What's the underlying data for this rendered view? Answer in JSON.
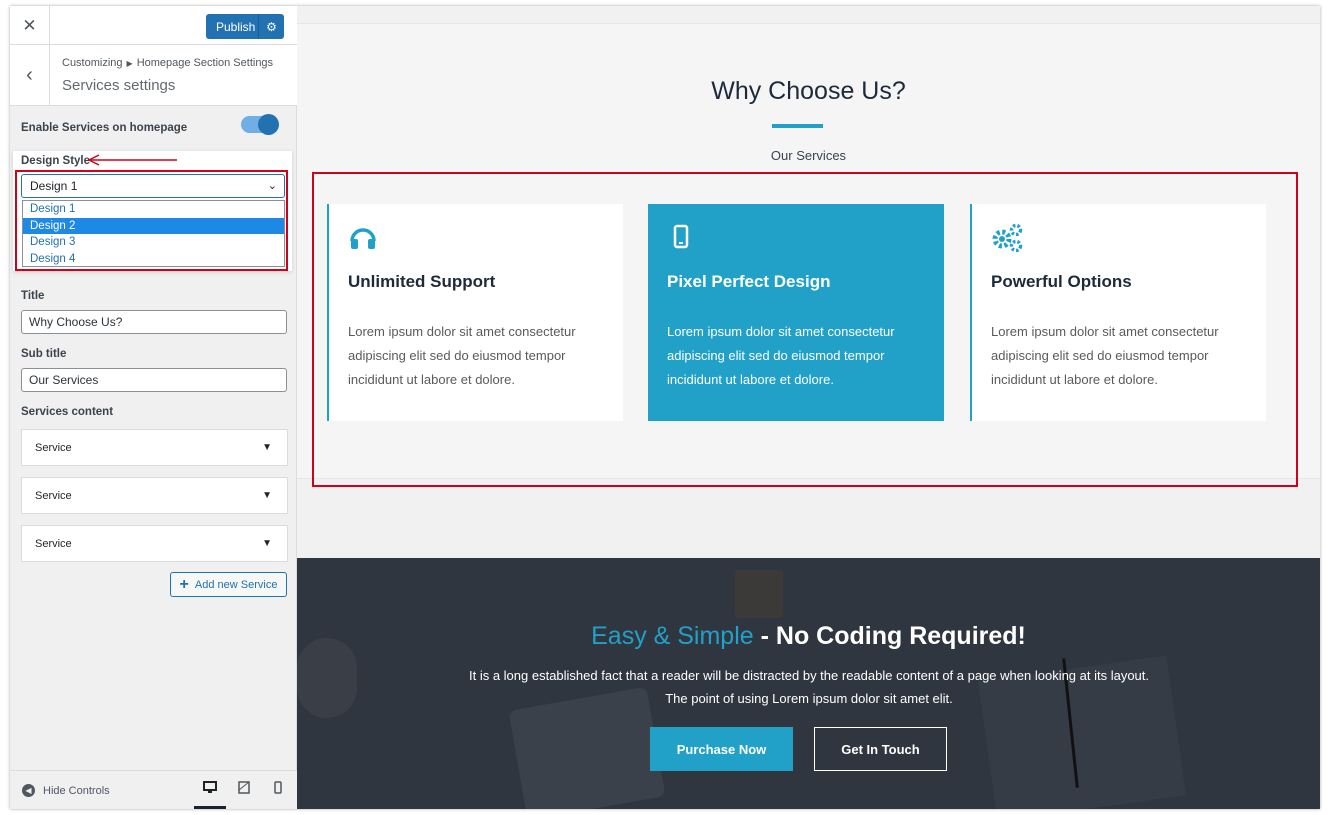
{
  "sidebar": {
    "publish_label": "Publish",
    "breadcrumb": [
      "Customizing",
      "Homepage Section Settings"
    ],
    "section_title": "Services settings",
    "enable_label": "Enable Services on homepage",
    "enable_on": true,
    "design_style": {
      "label": "Design Style",
      "selected": "Design 1",
      "options": [
        "Design 1",
        "Design 2",
        "Design 3",
        "Design 4"
      ],
      "highlighted": "Design 2"
    },
    "title_label": "Title",
    "title_value": "Why Choose Us?",
    "subtitle_label": "Sub title",
    "subtitle_value": "Our Services",
    "services_label": "Services content",
    "services": [
      "Service",
      "Service",
      "Service"
    ],
    "add_service_label": "Add new Service",
    "hide_controls_label": "Hide Controls",
    "colors": {
      "accent": "#2271b1",
      "annotation": "#d0021b"
    }
  },
  "preview": {
    "why_title": "Why Choose Us?",
    "why_subtitle": "Our Services",
    "cards": [
      {
        "icon": "headphones-icon",
        "title": "Unlimited Support",
        "text": "Lorem ipsum dolor sit amet consectetur adipiscing elit sed do eiusmod tempor incididunt ut labore et dolore.",
        "highlighted": false
      },
      {
        "icon": "mobile-icon",
        "title": "Pixel Perfect Design",
        "text": "Lorem ipsum dolor sit amet consectetur adipiscing elit sed do eiusmod tempor incididunt ut labore et dolore.",
        "highlighted": true
      },
      {
        "icon": "cogs-icon",
        "title": "Powerful Options",
        "text": "Lorem ipsum dolor sit amet consectetur adipiscing elit sed do eiusmod tempor incididunt ut labore et dolore.",
        "highlighted": false
      }
    ],
    "cta": {
      "title_accent": "Easy & Simple",
      "title_rest": " - No Coding Required!",
      "text": "It is a long established fact that a reader will be distracted by the readable content of a page when looking at its layout. The point of using Lorem ipsum dolor sit amet elit.",
      "primary_button": "Purchase Now",
      "secondary_button": "Get In Touch"
    },
    "colors": {
      "accent": "#21a1c8",
      "dark_bg": "#303640"
    }
  }
}
